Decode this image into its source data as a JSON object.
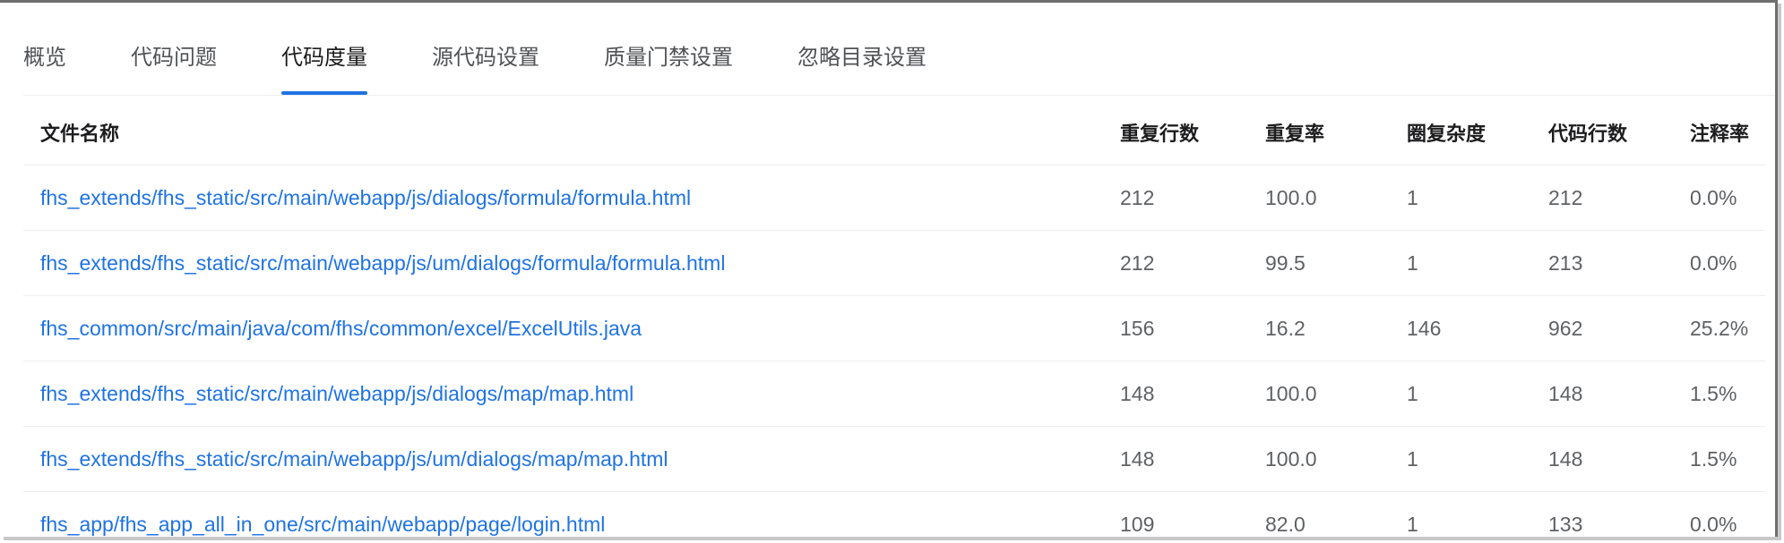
{
  "tabs": [
    {
      "label": "概览",
      "active": false
    },
    {
      "label": "代码问题",
      "active": false
    },
    {
      "label": "代码度量",
      "active": true
    },
    {
      "label": "源代码设置",
      "active": false
    },
    {
      "label": "质量门禁设置",
      "active": false
    },
    {
      "label": "忽略目录设置",
      "active": false
    }
  ],
  "table": {
    "headers": {
      "file": "文件名称",
      "dup_lines": "重复行数",
      "dup_rate": "重复率",
      "complexity": "圈复杂度",
      "loc": "代码行数",
      "comment_rate": "注释率"
    },
    "rows": [
      {
        "file": "fhs_extends/fhs_static/src/main/webapp/js/dialogs/formula/formula.html",
        "dup_lines": "212",
        "dup_rate": "100.0",
        "complexity": "1",
        "loc": "212",
        "comment_rate": "0.0%"
      },
      {
        "file": "fhs_extends/fhs_static/src/main/webapp/js/um/dialogs/formula/formula.html",
        "dup_lines": "212",
        "dup_rate": "99.5",
        "complexity": "1",
        "loc": "213",
        "comment_rate": "0.0%"
      },
      {
        "file": "fhs_common/src/main/java/com/fhs/common/excel/ExcelUtils.java",
        "dup_lines": "156",
        "dup_rate": "16.2",
        "complexity": "146",
        "loc": "962",
        "comment_rate": "25.2%"
      },
      {
        "file": "fhs_extends/fhs_static/src/main/webapp/js/dialogs/map/map.html",
        "dup_lines": "148",
        "dup_rate": "100.0",
        "complexity": "1",
        "loc": "148",
        "comment_rate": "1.5%"
      },
      {
        "file": "fhs_extends/fhs_static/src/main/webapp/js/um/dialogs/map/map.html",
        "dup_lines": "148",
        "dup_rate": "100.0",
        "complexity": "1",
        "loc": "148",
        "comment_rate": "1.5%"
      },
      {
        "file": "fhs_app/fhs_app_all_in_one/src/main/webapp/page/login.html",
        "dup_lines": "109",
        "dup_rate": "82.0",
        "complexity": "1",
        "loc": "133",
        "comment_rate": "0.0%"
      }
    ]
  },
  "colors": {
    "accent": "#1f73e3",
    "link": "#1f73e3",
    "text": "#5f6164",
    "header_text": "#1d1d1f"
  }
}
